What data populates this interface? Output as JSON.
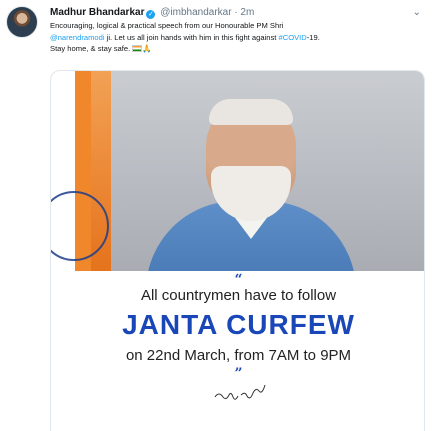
{
  "tweet": {
    "author_name": "Madhur Bhandarkar",
    "verified_mark": "✓",
    "handle_time": "@imbhandarkar · 2m",
    "menu_glyph": "⌄",
    "text": {
      "line1": "Encouraging, logical & practical speech from our Honourable PM Shri",
      "line2_mention": "@narendramodi",
      "line2_rest": " ji. Let us all join hands with him in this fight against ",
      "line2_hashtag": "#COVID",
      "line2_end": "-19.",
      "line3": "Stay home, & stay safe.",
      "line3_emoji": "🙏"
    },
    "icons": {
      "avatar": "avatar-image",
      "verified": "verified-badge-icon",
      "menu": "chevron-down-icon",
      "flag": "india-flag-emoji"
    }
  },
  "poster": {
    "quote_open": "“",
    "line1": "All countrymen have to follow",
    "line2": "JANTA CURFEW",
    "line3": "on 22nd March, from 7AM to 9PM",
    "quote_close": "”"
  },
  "colors": {
    "link": "#1da1f2",
    "poster_blue": "#1a47b8"
  }
}
